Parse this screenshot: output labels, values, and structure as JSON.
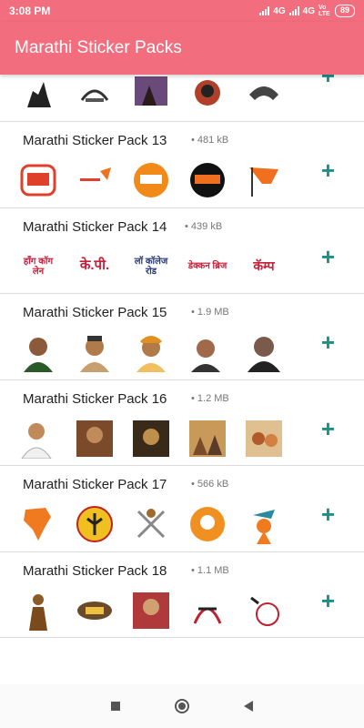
{
  "status_bar": {
    "time": "3:08 PM",
    "network1": "4G",
    "network2": "4G",
    "volte": "Vo LTE",
    "battery": "89"
  },
  "app_bar": {
    "title": "Marathi Sticker Packs"
  },
  "packs": [
    {
      "title": "Marathi Sticker Pack 13",
      "size": "• 481 kB"
    },
    {
      "title": "Marathi Sticker Pack 14",
      "size": "• 439 kB"
    },
    {
      "title": "Marathi Sticker Pack 15",
      "size": "• 1.9 MB"
    },
    {
      "title": "Marathi Sticker Pack 16",
      "size": "• 1.2 MB"
    },
    {
      "title": "Marathi Sticker Pack 17",
      "size": "• 566 kB"
    },
    {
      "title": "Marathi Sticker Pack 18",
      "size": "• 1.1 MB"
    }
  ],
  "pack14_stickers": [
    "हाँग कॉग लेन",
    "के.पी.",
    "लॉ कॉलेज रोड",
    "डेक्कन ब्रिज",
    "कॅम्प"
  ],
  "colors": {
    "accent": "#f26d7d",
    "add_button": "#1f8f83"
  }
}
